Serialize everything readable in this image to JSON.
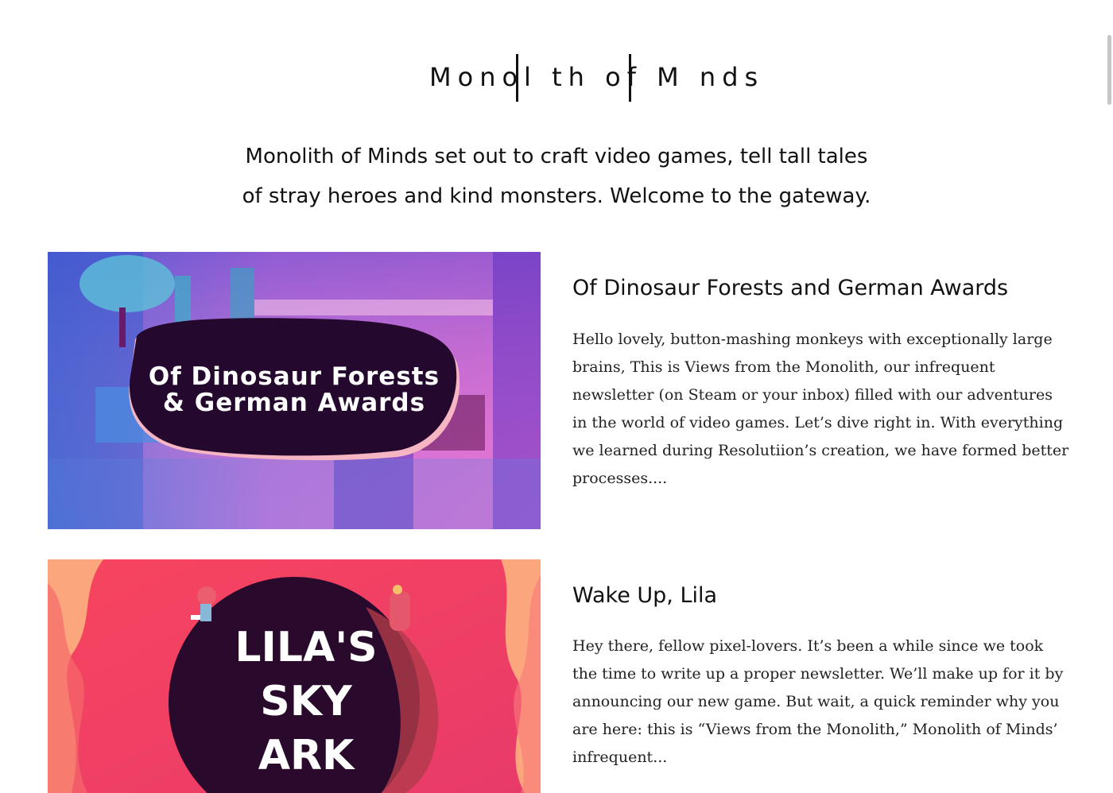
{
  "site": {
    "logo_text": "Monolith of Minds",
    "logo_display": "Monol th of M nds",
    "tagline_line1": "Monolith of Minds set out to craft video games, tell tall tales",
    "tagline_line2": "of stray heroes and kind monsters. Welcome to the gateway."
  },
  "posts": [
    {
      "title": "Of Dinosaur Forests and German Awards",
      "image_caption_line1": "Of Dinosaur Forests",
      "image_caption_line2": "& German Awards",
      "excerpt": "Hello lovely, button-mashing monkeys with exceptionally large brains, This is Views from the Monolith, our infrequent newsletter (on Steam or your inbox) filled with our adventures in the world of video games. Let’s dive right in. With everything we learned during Resolutiion’s creation, we have formed better processes...."
    },
    {
      "title": "Wake Up, Lila",
      "image_caption_line1": "LILA'S",
      "image_caption_line2": "SKY",
      "image_caption_line3": "ARK",
      "excerpt": "Hey there, fellow pixel-lovers. It’s been a while since we took the time to write up a proper newsletter. We’ll make up for it by announcing our new game. But wait, a quick reminder why you are here: this is “Views from the Monolith,” Monolith of Minds’ infrequent..."
    }
  ],
  "colors": {
    "text": "#111111",
    "post1_bg_a": "#3a6fd8",
    "post1_bg_b": "#e86fd0",
    "post1_blob": "#24082e",
    "post2_bg_a": "#f7455f",
    "post2_bg_b": "#fca67d",
    "post2_planet": "#2a0a2c"
  }
}
